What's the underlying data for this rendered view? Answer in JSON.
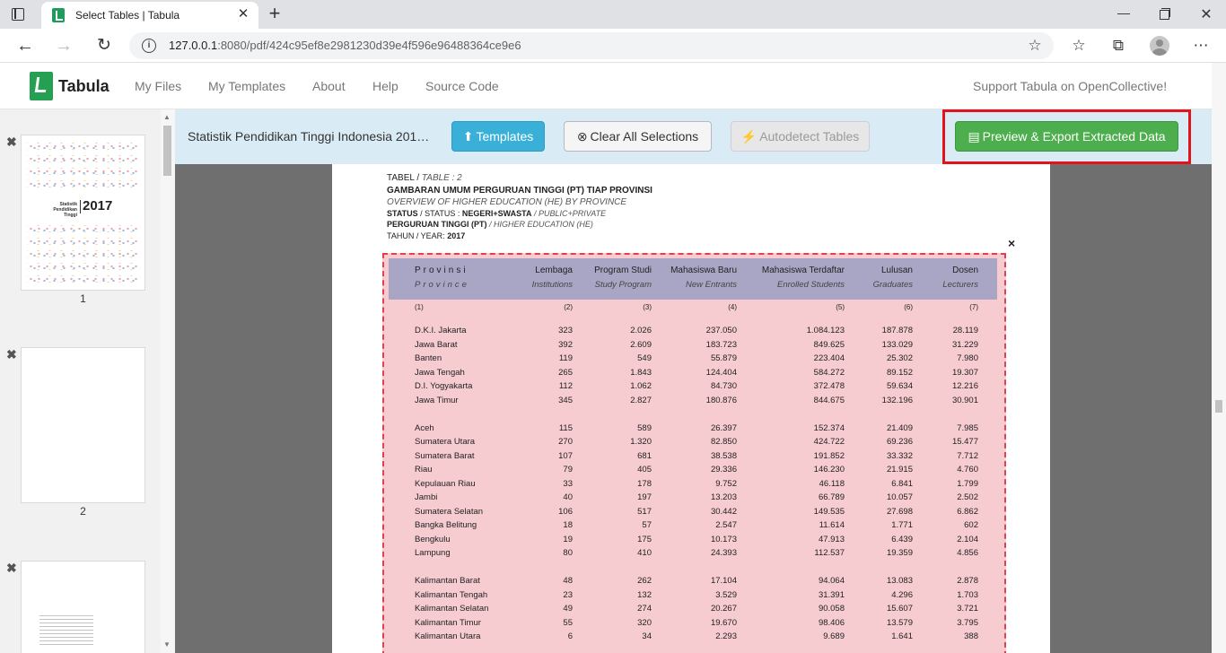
{
  "browser": {
    "tab_title": "Select Tables | Tabula",
    "tab_close": "✕",
    "new_tab": "+",
    "url_host": "127.0.0.1",
    "url_rest": ":8080/pdf/424c95ef8e2981230d39e4f596e96488364ce9e6"
  },
  "navbar": {
    "brand": "Tabula",
    "links": [
      "My Files",
      "My Templates",
      "About",
      "Help",
      "Source Code"
    ],
    "support": "Support Tabula on OpenCollective!"
  },
  "sidebar": {
    "pages": [
      {
        "num": "1",
        "thumb_title": "Statistik Pendidikan Tinggi",
        "thumb_year": "2017"
      },
      {
        "num": "2"
      },
      {
        "num": ""
      }
    ]
  },
  "actionbar": {
    "doc_title": "Statistik Pendidikan Tinggi Indonesia 201…",
    "templates": "Templates",
    "clear": "Clear All Selections",
    "autodetect": "Autodetect Tables",
    "preview": "Preview & Export Extracted Data"
  },
  "doc": {
    "line1_a": "TABEL / ",
    "line1_b": "TABLE : 2",
    "line2": "GAMBARAN UMUM PERGURUAN TINGGI (PT) TIAP PROVINSI",
    "line3": "OVERVIEW OF HIGHER EDUCATION (HE) BY PROVINCE",
    "line4_a": "STATUS",
    "line4_b": " / STATUS : ",
    "line4_c": "NEGERI+SWASTA",
    "line4_d": " / PUBLIC+PRIVATE",
    "line5_a": "PERGURUAN TINGGI (PT)",
    "line5_b": " / HIGHER EDUCATION (HE)",
    "line6_a": "TAHUN / YEAR: ",
    "line6_b": "2017",
    "selection_close": "×"
  },
  "table": {
    "headers": [
      {
        "id": "Provinsi",
        "en": "Province"
      },
      {
        "id": "Lembaga",
        "en": "Institutions"
      },
      {
        "id": "Program Studi",
        "en": "Study Program"
      },
      {
        "id": "Mahasiswa Baru",
        "en": "New Entrants"
      },
      {
        "id": "Mahasiswa Terdaftar",
        "en": "Enrolled Students"
      },
      {
        "id": "Lulusan",
        "en": "Graduates"
      },
      {
        "id": "Dosen",
        "en": "Lecturers"
      }
    ],
    "colnums": [
      "(1)",
      "(2)",
      "(3)",
      "(4)",
      "(5)",
      "(6)",
      "(7)"
    ],
    "rows": [
      [
        "D.K.I. Jakarta",
        "323",
        "2.026",
        "237.050",
        "1.084.123",
        "187.878",
        "28.119"
      ],
      [
        "Jawa Barat",
        "392",
        "2.609",
        "183.723",
        "849.625",
        "133.029",
        "31.229"
      ],
      [
        "Banten",
        "119",
        "549",
        "55.879",
        "223.404",
        "25.302",
        "7.980"
      ],
      [
        "Jawa Tengah",
        "265",
        "1.843",
        "124.404",
        "584.272",
        "89.152",
        "19.307"
      ],
      [
        "D.I. Yogyakarta",
        "112",
        "1.062",
        "84.730",
        "372.478",
        "59.634",
        "12.216"
      ],
      [
        "Jawa Timur",
        "345",
        "2.827",
        "180.876",
        "844.675",
        "132.196",
        "30.901"
      ],
      [
        "Aceh",
        "115",
        "589",
        "26.397",
        "152.374",
        "21.409",
        "7.985"
      ],
      [
        "Sumatera Utara",
        "270",
        "1.320",
        "82.850",
        "424.722",
        "69.236",
        "15.477"
      ],
      [
        "Sumatera Barat",
        "107",
        "681",
        "38.538",
        "191.852",
        "33.332",
        "7.712"
      ],
      [
        "Riau",
        "79",
        "405",
        "29.336",
        "146.230",
        "21.915",
        "4.760"
      ],
      [
        "Kepulauan Riau",
        "33",
        "178",
        "9.752",
        "46.118",
        "6.841",
        "1.799"
      ],
      [
        "Jambi",
        "40",
        "197",
        "13.203",
        "66.789",
        "10.057",
        "2.502"
      ],
      [
        "Sumatera Selatan",
        "106",
        "517",
        "30.442",
        "149.535",
        "27.698",
        "6.862"
      ],
      [
        "Bangka Belitung",
        "18",
        "57",
        "2.547",
        "11.614",
        "1.771",
        "602"
      ],
      [
        "Bengkulu",
        "19",
        "175",
        "10.173",
        "47.913",
        "6.439",
        "2.104"
      ],
      [
        "Lampung",
        "80",
        "410",
        "24.393",
        "112.537",
        "19.359",
        "4.856"
      ],
      [
        "Kalimantan Barat",
        "48",
        "262",
        "17.104",
        "94.064",
        "13.083",
        "2.878"
      ],
      [
        "Kalimantan Tengah",
        "23",
        "132",
        "3.529",
        "31.391",
        "4.296",
        "1.703"
      ],
      [
        "Kalimantan Selatan",
        "49",
        "274",
        "20.267",
        "90.058",
        "15.607",
        "3.721"
      ],
      [
        "Kalimantan Timur",
        "55",
        "320",
        "19.670",
        "98.406",
        "13.579",
        "3.795"
      ],
      [
        "Kalimantan Utara",
        "6",
        "34",
        "2.293",
        "9.689",
        "1.641",
        "388"
      ]
    ]
  }
}
